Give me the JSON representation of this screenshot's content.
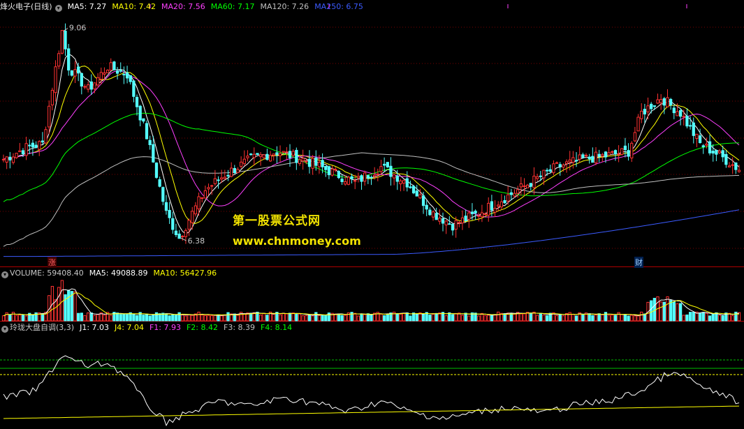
{
  "price_pane": {
    "title": "烽火电子(日线)",
    "indicators": [
      {
        "label": "MA5: 7.27",
        "color": "#ffffff"
      },
      {
        "label": "MA10: 7.42",
        "color": "#ffff00"
      },
      {
        "label": "MA20: 7.56",
        "color": "#ff40ff"
      },
      {
        "label": "MA60: 7.17",
        "color": "#00ff00"
      },
      {
        "label": "MA120: 7.26",
        "color": "#c0c0c0"
      },
      {
        "label": "MA250: 6.75",
        "color": "#3b5bff"
      }
    ],
    "high_label": "9.06",
    "low_label": "6.38",
    "tag_left": "涨",
    "tag_right": "财"
  },
  "volume_pane": {
    "indicators": [
      {
        "label": "VOLUME: 59408.40",
        "color": "#c8c8c8"
      },
      {
        "label": "MA5: 49088.89",
        "color": "#ffffff"
      },
      {
        "label": "MA10: 56427.96",
        "color": "#ffff00"
      }
    ]
  },
  "osc_pane": {
    "indicators": [
      {
        "label": "玲珑大盘自调(3,3)",
        "color": "#c8c8c8"
      },
      {
        "label": "J1: 7.03",
        "color": "#ffffff"
      },
      {
        "label": "J4: 7.04",
        "color": "#ffff00"
      },
      {
        "label": "F1: 7.93",
        "color": "#ff40ff"
      },
      {
        "label": "F2: 8.42",
        "color": "#00ff00"
      },
      {
        "label": "F3: 8.39",
        "color": "#c0c0c0"
      },
      {
        "label": "F4: 8.14",
        "color": "#00ff00"
      }
    ]
  },
  "watermark": {
    "line1": "第一股票公式网",
    "line2": "www.chnmoney.com"
  },
  "colors": {
    "up": "#ff3232",
    "down": "#54ffff",
    "ma5": "#ffffff",
    "ma10": "#ffff00",
    "ma20": "#ff40ff",
    "ma60": "#00ff00",
    "ma120": "#c0c0c0",
    "ma250": "#3b5bff"
  },
  "chart_data": [
    {
      "type": "candlestick",
      "title": "烽火电子(日线)",
      "ylim": [
        6.1,
        9.3
      ],
      "key_points": [
        {
          "index": 0,
          "close": 7.4
        },
        {
          "index": 7,
          "close": 7.55
        },
        {
          "index": 12,
          "close": 7.6
        },
        {
          "index": 18,
          "close": 9.06
        },
        {
          "index": 20,
          "close": 8.6
        },
        {
          "index": 26,
          "close": 8.3
        },
        {
          "index": 32,
          "close": 8.6
        },
        {
          "index": 38,
          "close": 8.5
        },
        {
          "index": 44,
          "close": 7.7
        },
        {
          "index": 50,
          "close": 6.7
        },
        {
          "index": 54,
          "close": 6.38
        },
        {
          "index": 58,
          "close": 6.7
        },
        {
          "index": 62,
          "close": 7.0
        },
        {
          "index": 68,
          "close": 7.2
        },
        {
          "index": 76,
          "close": 7.4
        },
        {
          "index": 84,
          "close": 7.5
        },
        {
          "index": 92,
          "close": 7.4
        },
        {
          "index": 100,
          "close": 7.25
        },
        {
          "index": 108,
          "close": 7.1
        },
        {
          "index": 116,
          "close": 7.3
        },
        {
          "index": 124,
          "close": 7.1
        },
        {
          "index": 132,
          "close": 6.7
        },
        {
          "index": 138,
          "close": 6.55
        },
        {
          "index": 146,
          "close": 6.7
        },
        {
          "index": 154,
          "close": 6.9
        },
        {
          "index": 162,
          "close": 7.1
        },
        {
          "index": 170,
          "close": 7.3
        },
        {
          "index": 178,
          "close": 7.4
        },
        {
          "index": 186,
          "close": 7.45
        },
        {
          "index": 192,
          "close": 7.5
        },
        {
          "index": 196,
          "close": 8.0
        },
        {
          "index": 202,
          "close": 8.2
        },
        {
          "index": 208,
          "close": 8.0
        },
        {
          "index": 214,
          "close": 7.6
        },
        {
          "index": 220,
          "close": 7.45
        },
        {
          "index": 226,
          "close": 7.27
        }
      ],
      "moving_averages": [
        "MA5",
        "MA10",
        "MA20",
        "MA60",
        "MA120",
        "MA250"
      ]
    },
    {
      "type": "bar",
      "title": "VOLUME",
      "series": [
        {
          "name": "VOLUME",
          "last": 59408.4
        },
        {
          "name": "MA5",
          "last": 49088.89
        },
        {
          "name": "MA10",
          "last": 56427.96
        }
      ]
    },
    {
      "type": "line",
      "title": "玲珑大盘自调(3,3)",
      "series": [
        {
          "name": "J1",
          "last": 7.03
        },
        {
          "name": "J4",
          "last": 7.04
        },
        {
          "name": "F1",
          "last": 7.93
        },
        {
          "name": "F2",
          "last": 8.42
        },
        {
          "name": "F3",
          "last": 8.39
        },
        {
          "name": "F4",
          "last": 8.14
        }
      ]
    }
  ]
}
